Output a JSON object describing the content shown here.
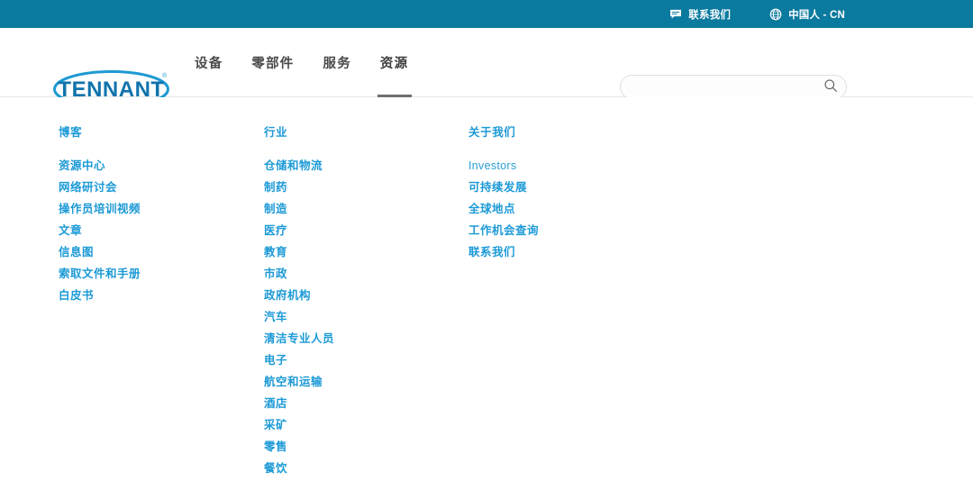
{
  "colors": {
    "utility_bar_bg": "#0a7a9e",
    "link_blue": "#1c9ad6",
    "nav_text": "#4b4b4b",
    "active_underline": "#6e7072",
    "logo_blue": "#1e9ad3"
  },
  "utility_bar": {
    "items": [
      {
        "icon": "chat-bubble-icon",
        "label": "联系我们"
      },
      {
        "icon": "globe-icon",
        "label": "中国人 - CN"
      }
    ]
  },
  "header": {
    "logo": {
      "text": "TENNANT",
      "trademark": "®",
      "name": "tennant-logo"
    },
    "nav": [
      {
        "label": "设备",
        "active": false
      },
      {
        "label": "零部件",
        "active": false
      },
      {
        "label": "服务",
        "active": false
      },
      {
        "label": "资源",
        "active": true
      }
    ],
    "search": {
      "value": "",
      "placeholder": "",
      "icon": "search-icon"
    }
  },
  "mega_menu": {
    "columns": [
      {
        "name": "resources-column",
        "heading": "博客",
        "items": [
          "资源中心",
          "网络研讨会",
          "操作员培训视频",
          "文章",
          "信息图",
          "索取文件和手册",
          "白皮书"
        ]
      },
      {
        "name": "industries-column",
        "heading": "行业",
        "items": [
          "仓储和物流",
          "制药",
          "制造",
          "医疗",
          "教育",
          "市政",
          "政府机构",
          "汽车",
          "清洁专业人员",
          "电子",
          "航空和运输",
          "酒店",
          "采矿",
          "零售",
          "餐饮"
        ]
      },
      {
        "name": "about-column",
        "heading": "关于我们",
        "items": [
          "Investors",
          "可持续发展",
          "全球地点",
          "工作机会查询",
          "联系我们"
        ]
      }
    ]
  }
}
